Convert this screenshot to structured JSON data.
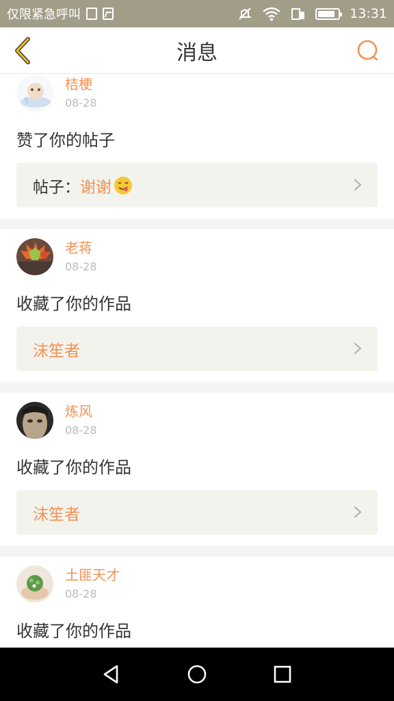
{
  "status_bar": {
    "carrier": "仅限紧急呼叫",
    "time": "13:31",
    "icons": [
      "sim-icon",
      "image-icon",
      "mute-icon",
      "wifi-icon",
      "data-icon",
      "battery-icon"
    ]
  },
  "nav": {
    "title": "消息",
    "back_icon": "chevron-left-icon",
    "search_icon": "search-icon"
  },
  "messages": [
    {
      "user": "桔梗",
      "date": "08-28",
      "action": "赞了你的帖子",
      "ref_prefix": "帖子：",
      "ref_title": "谢谢",
      "ref_emoji": "face-emoji"
    },
    {
      "user": "老蒋",
      "date": "08-28",
      "action": "收藏了你的作品",
      "ref_prefix": "",
      "ref_title": "沫笙者"
    },
    {
      "user": "炼风",
      "date": "08-28",
      "action": "收藏了你的作品",
      "ref_prefix": "",
      "ref_title": "沫笙者"
    },
    {
      "user": "土匪天才",
      "date": "08-28",
      "action": "收藏了你的作品",
      "ref_prefix": "",
      "ref_title": ""
    }
  ],
  "colors": {
    "accent": "#f39253",
    "status_bar": "#a29d88",
    "back_icon": "#f0c419",
    "card_box": "#f3f3ee"
  },
  "system_nav": [
    "back-triangle-icon",
    "home-circle-icon",
    "recents-square-icon"
  ]
}
